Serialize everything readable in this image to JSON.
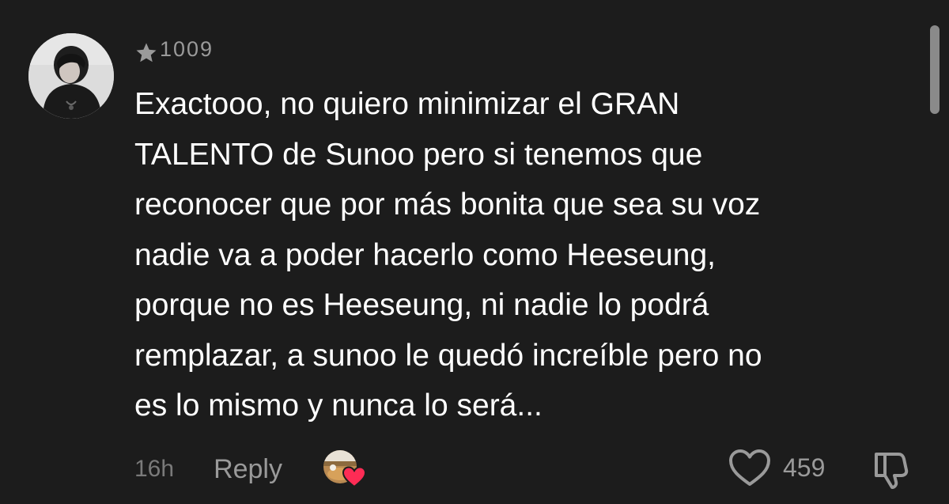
{
  "comment": {
    "username": "1009",
    "text_lines": [
      "Exactooo, no quiero minimizar el GRAN",
      "TALENTO de Sunoo pero si tenemos que",
      "reconocer que por más bonita que sea su voz",
      "nadie va a poder hacerlo como Heeseung,",
      "porque no es Heeseung, ni nadie lo podrá",
      "remplazar, a sunoo le quedó increíble pero no",
      "es lo mismo y nunca lo será..."
    ],
    "timestamp": "16h",
    "reply_label": "Reply",
    "like_count": "459"
  },
  "icons": {
    "star": "star-icon",
    "heart": "heart-outline-icon",
    "dislike": "thumbs-down-icon",
    "creator_liked": "creator-liked-heart-icon"
  },
  "colors": {
    "background": "#1c1c1c",
    "text": "#ffffff",
    "muted": "#9a9a9a",
    "creator_heart": "#fe2c55"
  }
}
